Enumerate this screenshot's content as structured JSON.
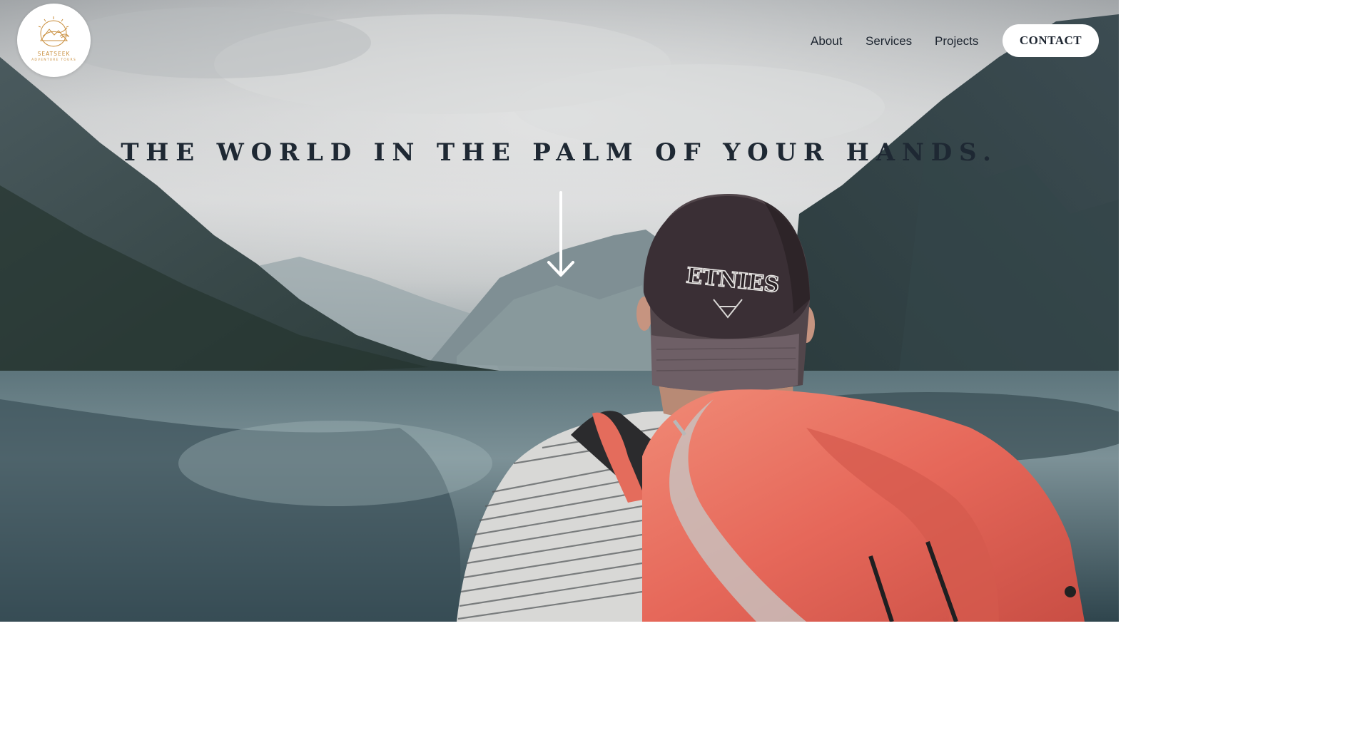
{
  "logo": {
    "name": "SEATSEEK",
    "tagline": "ADVENTURE TOURS",
    "accent": "#c98e3c"
  },
  "nav": {
    "items": [
      {
        "label": "About"
      },
      {
        "label": "Services"
      },
      {
        "label": "Projects"
      }
    ],
    "contact_label": "CONTACT"
  },
  "hero": {
    "headline": "THE WORLD IN THE PALM OF YOUR HANDS.",
    "cap_text": "ETNIES",
    "scroll_icon": "arrow-down-icon"
  },
  "colors": {
    "text_dark": "#1e2833",
    "button_bg": "#ffffff",
    "backpack": "#e9705e"
  }
}
